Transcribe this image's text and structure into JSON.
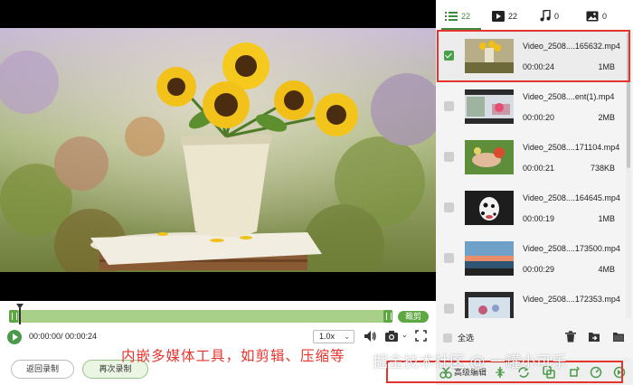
{
  "player": {
    "trim_label": "裁剪",
    "time_readout": "00:00:00/ 00:00:24",
    "speed": "1.0x",
    "back_label": "返回录制",
    "record_again_label": "再次录制"
  },
  "annotation": {
    "text": "内嵌多媒体工具，如剪辑、压缩等",
    "color": "#e5342d"
  },
  "watermark": "掘金技术社区 @ 一罐小可乐",
  "tabs": [
    {
      "icon": "list-icon",
      "count": "22"
    },
    {
      "icon": "video-icon",
      "count": "22"
    },
    {
      "icon": "music-icon",
      "count": "0"
    },
    {
      "icon": "image-icon",
      "count": "0"
    }
  ],
  "files": [
    {
      "name": "Video_2508....165632.mp4",
      "duration": "00:00:24",
      "size": "1MB",
      "checked": true
    },
    {
      "name": "Video_2508....ent(1).mp4",
      "duration": "00:00:20",
      "size": "2MB",
      "checked": false
    },
    {
      "name": "Video_2508....171104.mp4",
      "duration": "00:00:21",
      "size": "738KB",
      "checked": false
    },
    {
      "name": "Video_2508....164645.mp4",
      "duration": "00:00:19",
      "size": "1MB",
      "checked": false
    },
    {
      "name": "Video_2508....173500.mp4",
      "duration": "00:00:29",
      "size": "4MB",
      "checked": false
    },
    {
      "name": "Video_2508....172353.mp4",
      "duration": "",
      "size": "",
      "checked": false
    }
  ],
  "select_all_label": "全选",
  "toolbar": {
    "label": "高级编辑"
  },
  "colors": {
    "accent": "#3c8a3c",
    "timeline": "#a8cf88",
    "highlight": "#e5342d"
  }
}
